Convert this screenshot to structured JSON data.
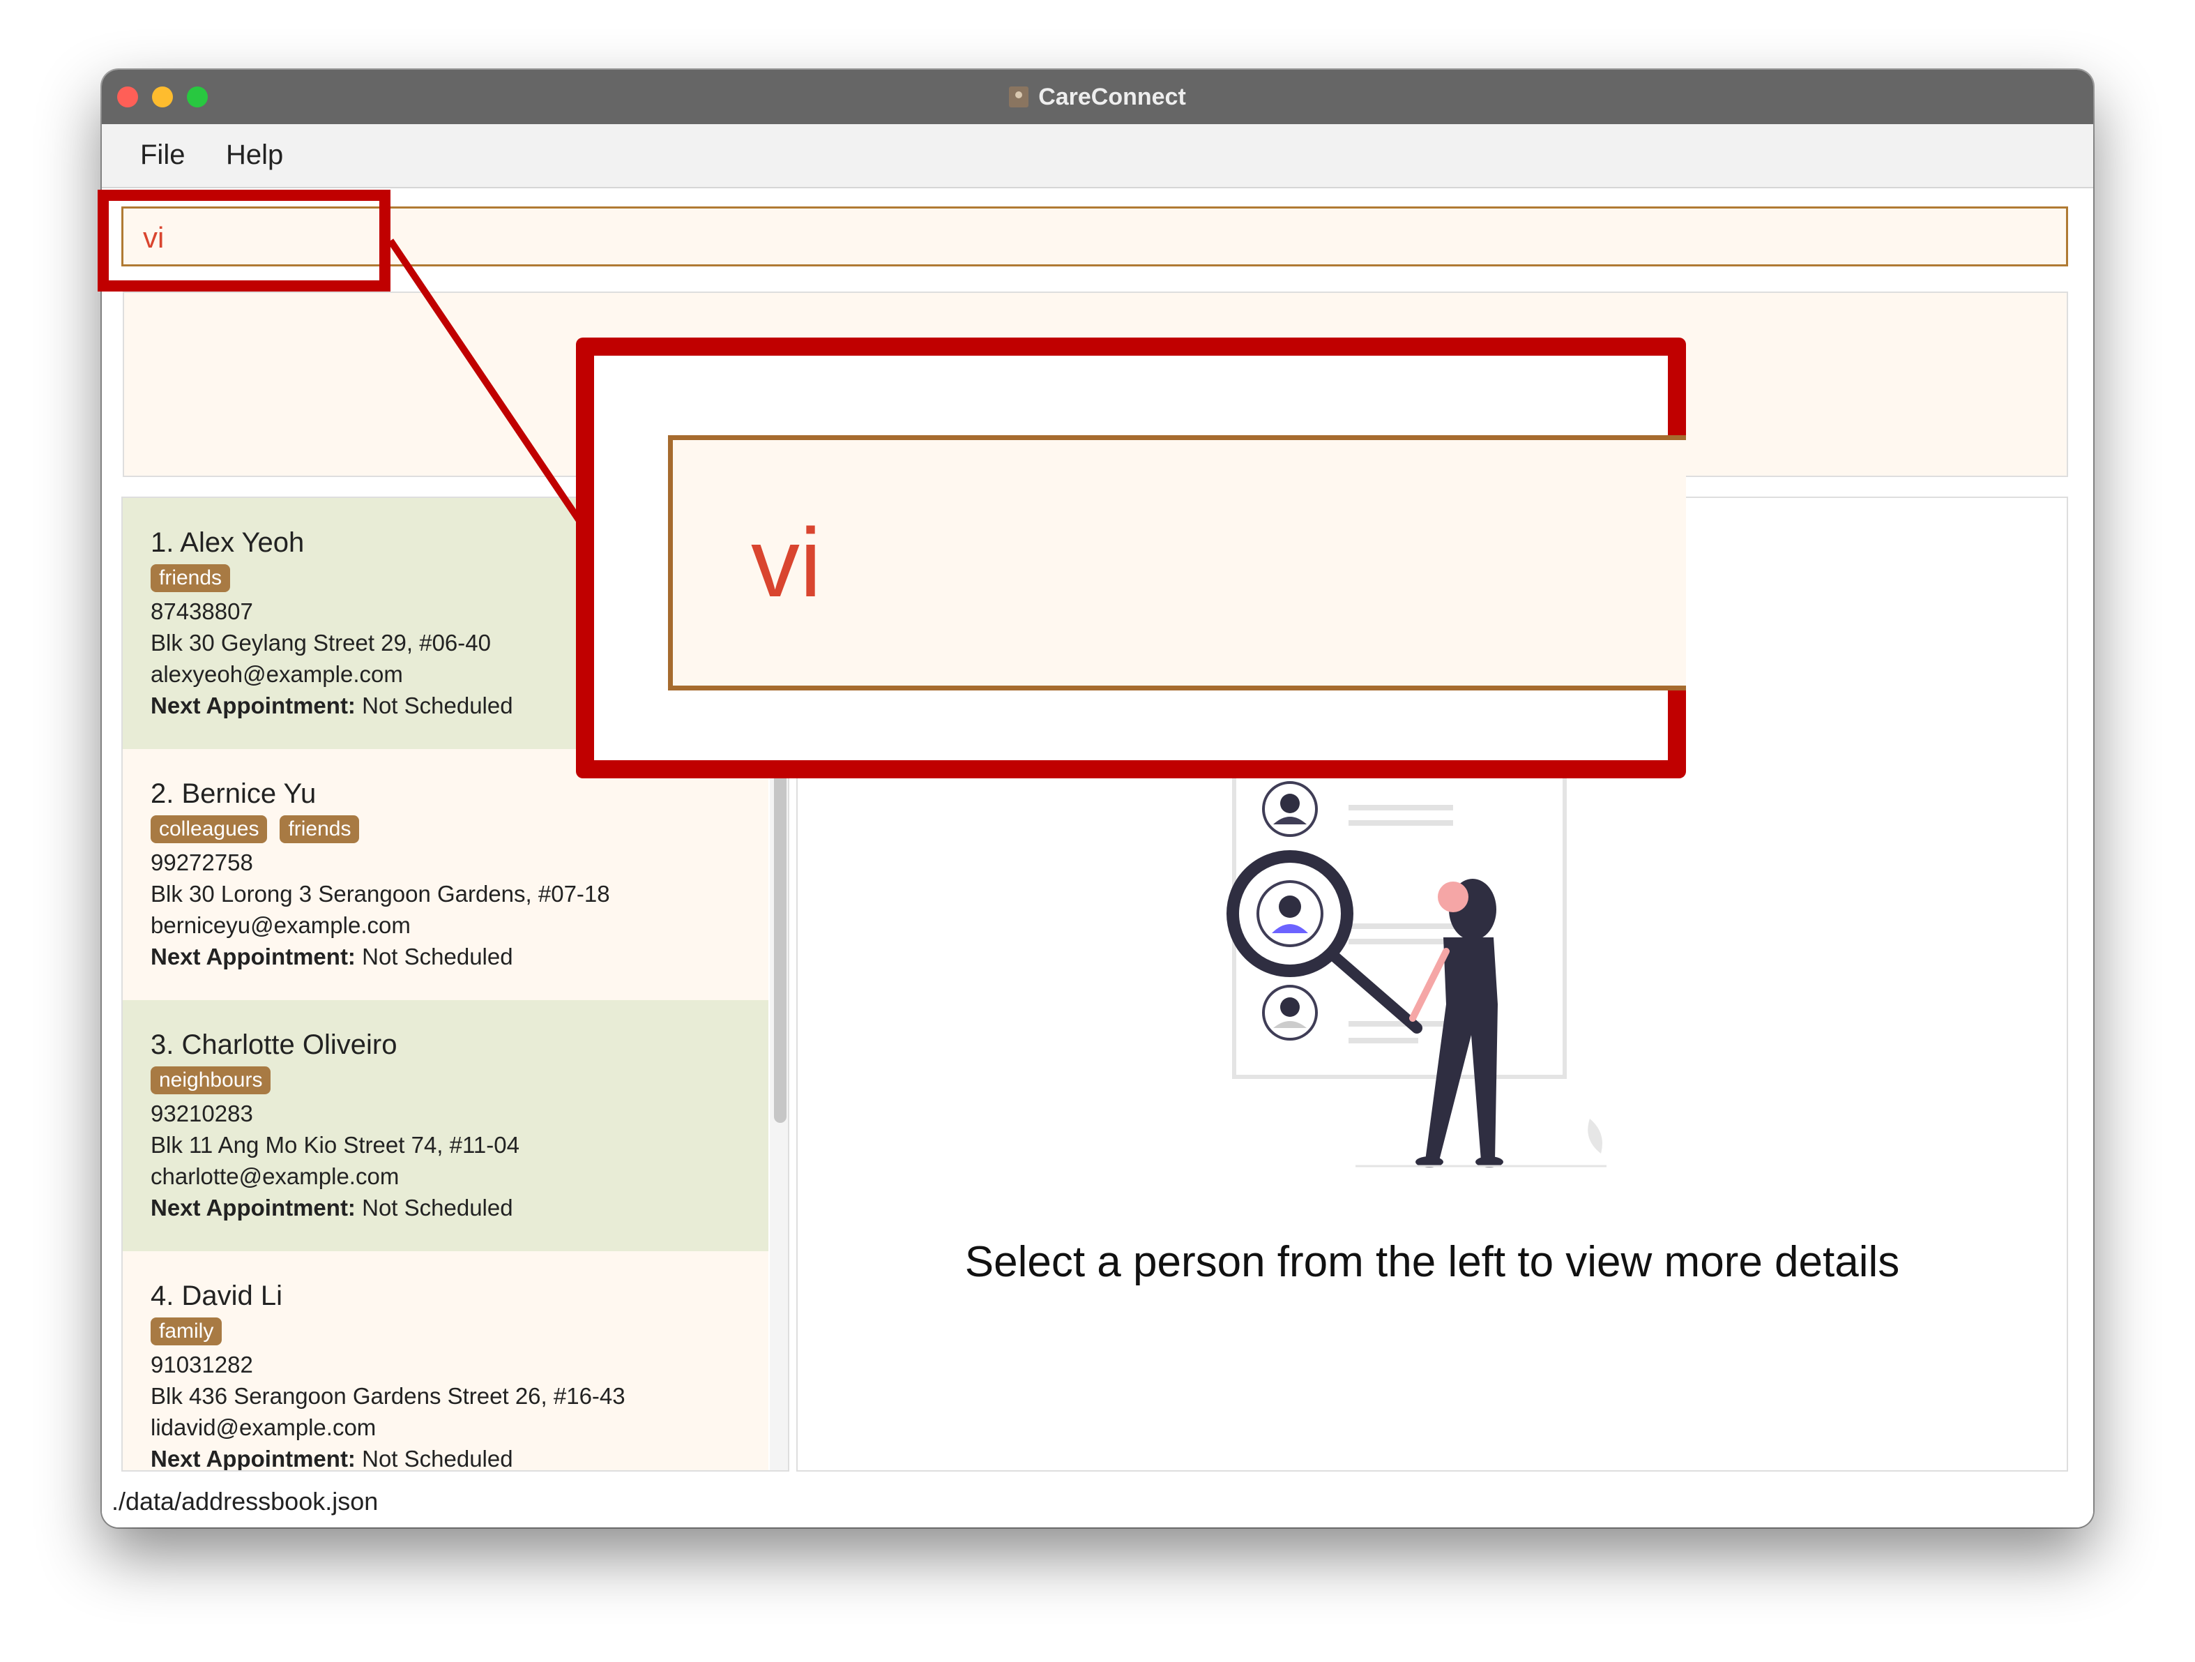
{
  "window": {
    "title": "CareConnect"
  },
  "menu": {
    "file": "File",
    "help": "Help"
  },
  "command": {
    "value": "vi"
  },
  "persons": [
    {
      "index_name": "1. Alex Yeoh",
      "tags": [
        "friends"
      ],
      "phone": "87438807",
      "address": "Blk 30 Geylang Street 29, #06-40",
      "email": "alexyeoh@example.com",
      "appointment_label": "Next Appointment:",
      "appointment": "Not Scheduled"
    },
    {
      "index_name": "2. Bernice Yu",
      "tags": [
        "colleagues",
        "friends"
      ],
      "phone": "99272758",
      "address": "Blk 30 Lorong 3 Serangoon Gardens, #07-18",
      "email": "berniceyu@example.com",
      "appointment_label": "Next Appointment:",
      "appointment": "Not Scheduled"
    },
    {
      "index_name": "3. Charlotte Oliveiro",
      "tags": [
        "neighbours"
      ],
      "phone": "93210283",
      "address": "Blk 11 Ang Mo Kio Street 74, #11-04",
      "email": "charlotte@example.com",
      "appointment_label": "Next Appointment:",
      "appointment": "Not Scheduled"
    },
    {
      "index_name": "4. David Li",
      "tags": [
        "family"
      ],
      "phone": "91031282",
      "address": "Blk 436 Serangoon Gardens Street 26, #16-43",
      "email": "lidavid@example.com",
      "appointment_label": "Next Appointment:",
      "appointment": "Not Scheduled"
    }
  ],
  "detail": {
    "message": "Select a person from the left to view more details",
    "illustration": "person-search-illustration"
  },
  "status": {
    "file_path": "./data/addressbook.json"
  },
  "annotation": {
    "zoom_text": "vi",
    "color": "#c00000"
  },
  "colors": {
    "accent": "#b07a33",
    "tag": "#a87a43",
    "command_text": "#d9452f",
    "card_alt": "#e8ecd6",
    "card_base": "#fff8f0"
  }
}
